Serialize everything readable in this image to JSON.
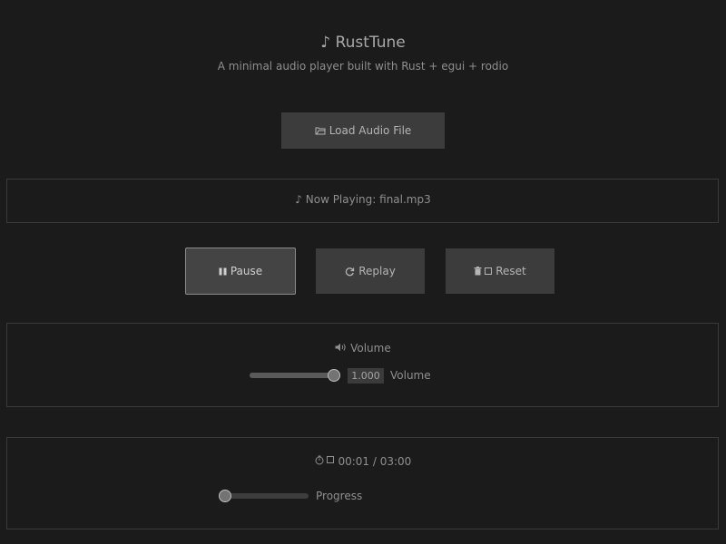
{
  "app": {
    "title": "RustTune",
    "subtitle": "A minimal audio player built with Rust + egui + rodio"
  },
  "load_button": {
    "label": "Load Audio File",
    "icon": "folder-icon"
  },
  "now_playing": {
    "text": "Now Playing: final.mp3",
    "icon": "music-note-icon"
  },
  "controls": {
    "pause": {
      "label": "Pause",
      "icon": "pause-icon"
    },
    "replay": {
      "label": "Replay",
      "icon": "replay-icon"
    },
    "reset": {
      "label": "Reset",
      "icon": "trash-icon"
    }
  },
  "volume": {
    "title": "Volume",
    "icon": "speaker-icon",
    "value": "1.000",
    "level": 1.0,
    "slider_label": "Volume"
  },
  "progress": {
    "time": "00:01 / 03:00",
    "icon": "stopwatch-icon",
    "fraction": 0.0,
    "slider_label": "Progress"
  }
}
